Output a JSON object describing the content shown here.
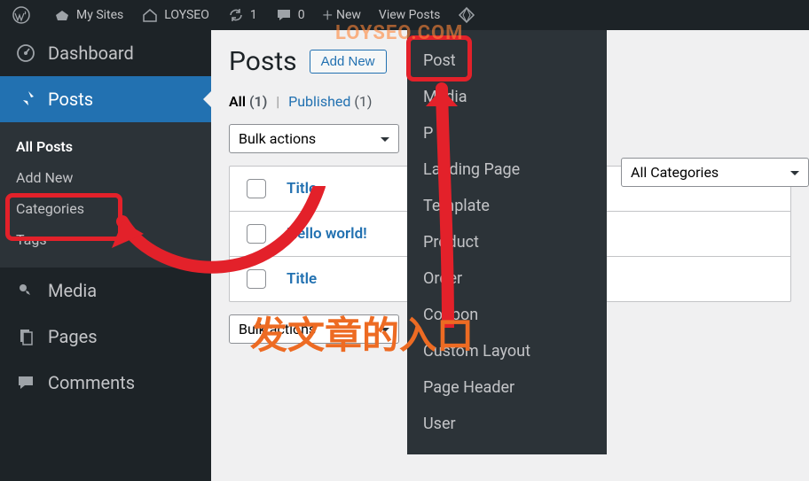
{
  "topbar": {
    "mysites": "My Sites",
    "sitename": "LOYSEO",
    "updates_count": "1",
    "comments_count": "0",
    "new_label": "New",
    "view_posts": "View Posts"
  },
  "sidebar": {
    "dashboard": "Dashboard",
    "posts": "Posts",
    "posts_sub": {
      "all": "All Posts",
      "add": "Add New",
      "categories": "Categories",
      "tags": "Tags"
    },
    "media": "Media",
    "pages": "Pages",
    "comments": "Comments"
  },
  "content": {
    "title": "Posts",
    "add_btn": "Add New",
    "views": {
      "all_label": "All",
      "all_count": "(1)",
      "pub_label": "Published",
      "pub_count": "(1)"
    },
    "bulk_actions": "Bulk actions",
    "all_categories": "All Categories",
    "table": {
      "header_title": "Title",
      "row1_title": "Hello world!",
      "row2_title": "Title"
    }
  },
  "new_dropdown": {
    "post": "Post",
    "media": "Media",
    "page": "P",
    "landing": "Landing Page",
    "template": "Template",
    "product": "Product",
    "order": "Order",
    "coupon": "Coupon",
    "custom_layout": "Custom Layout",
    "page_header": "Page Header",
    "user": "User"
  },
  "overlay": {
    "watermark": "LOYSEO.COM",
    "chinese": "发文章的入口"
  }
}
